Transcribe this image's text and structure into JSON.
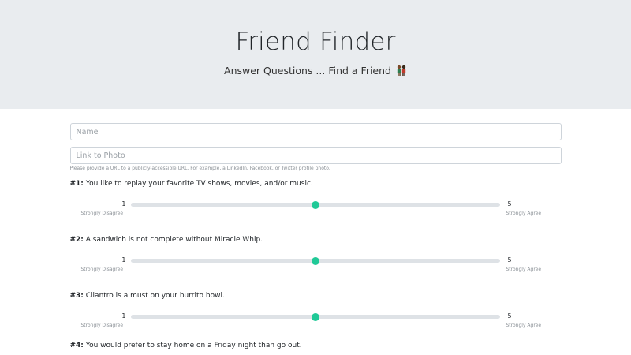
{
  "header": {
    "title": "Friend Finder",
    "subtitle": "Answer Questions ... Find a Friend",
    "subtitle_icon": "two-people-icon"
  },
  "form": {
    "name_placeholder": "Name",
    "photo_placeholder": "Link to Photo",
    "photo_help": "Please provide a URL to a publicly-accessible URL. For example, a LinkedIn, Facebook, or Twitter profile photo."
  },
  "questions": [
    {
      "number": "#1:",
      "text": " You like to replay your favorite TV shows, movies, and/or music.",
      "min": "1",
      "max": "5",
      "min_label": "Strongly Disagree",
      "max_label": "Strongly Agree",
      "value": 3
    },
    {
      "number": "#2:",
      "text": " A sandwich is not complete without Miracle Whip.",
      "min": "1",
      "max": "5",
      "min_label": "Strongly Disagree",
      "max_label": "Strongly Agree",
      "value": 3
    },
    {
      "number": "#3:",
      "text": " Cilantro is a must on your burrito bowl.",
      "min": "1",
      "max": "5",
      "min_label": "Strongly Disagree",
      "max_label": "Strongly Agree",
      "value": 3
    },
    {
      "number": "#4:",
      "text": " You would prefer to stay home on a Friday night than go out."
    }
  ],
  "colors": {
    "header_bg": "#e9ecef",
    "slider_thumb": "#20c997",
    "slider_track": "#dee2e6"
  }
}
